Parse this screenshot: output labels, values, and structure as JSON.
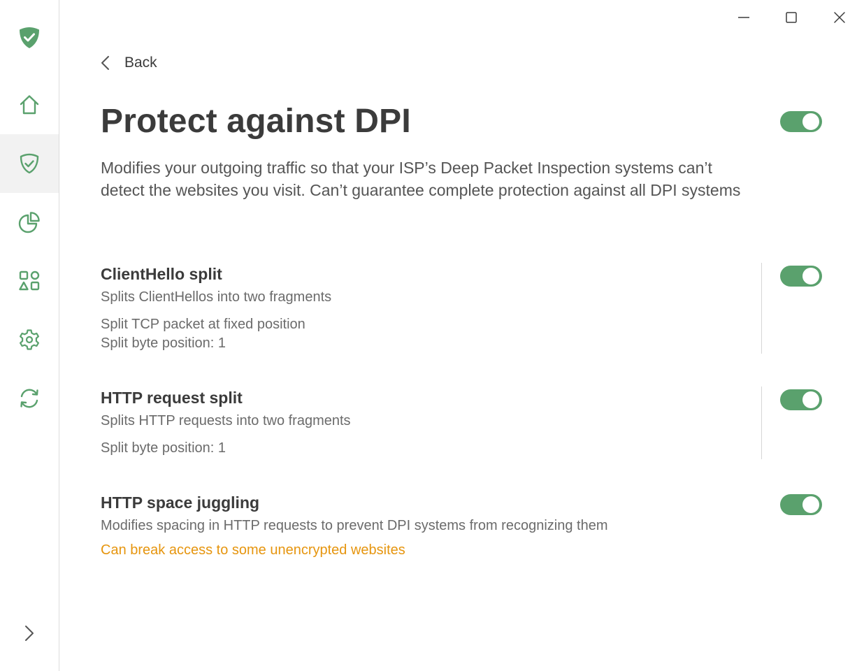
{
  "header": {
    "back_label": "Back",
    "title": "Protect against DPI",
    "description": "Modifies your outgoing traffic so that your ISP’s Deep Packet Inspection systems can’t detect the websites you visit. Can’t guarantee complete protection against all DPI systems",
    "enabled": true
  },
  "sidebar": {
    "items": [
      {
        "icon": "home-icon",
        "active": false
      },
      {
        "icon": "shield-icon",
        "active": true
      },
      {
        "icon": "statistics-icon",
        "active": false
      },
      {
        "icon": "apps-icon",
        "active": false
      },
      {
        "icon": "gear-icon",
        "active": false
      },
      {
        "icon": "sync-icon",
        "active": false
      }
    ]
  },
  "sections": {
    "clienthello": {
      "title": "ClientHello split",
      "subtitle": "Splits ClientHellos into two fragments",
      "mode": "Split TCP packet at fixed position",
      "position": "Split byte position: 1",
      "enabled": true
    },
    "http_split": {
      "title": "HTTP request split",
      "subtitle": "Splits HTTP requests into two fragments",
      "position": "Split byte position: 1",
      "enabled": true
    },
    "space_juggling": {
      "title": "HTTP space juggling",
      "subtitle": "Modifies spacing in HTTP requests to prevent DPI systems from recognizing them",
      "warning": "Can break access to some unencrypted websites",
      "enabled": true
    }
  },
  "colors": {
    "accent": "#5aa16d",
    "warning": "#e6950e",
    "text": "#3b3b3b"
  }
}
